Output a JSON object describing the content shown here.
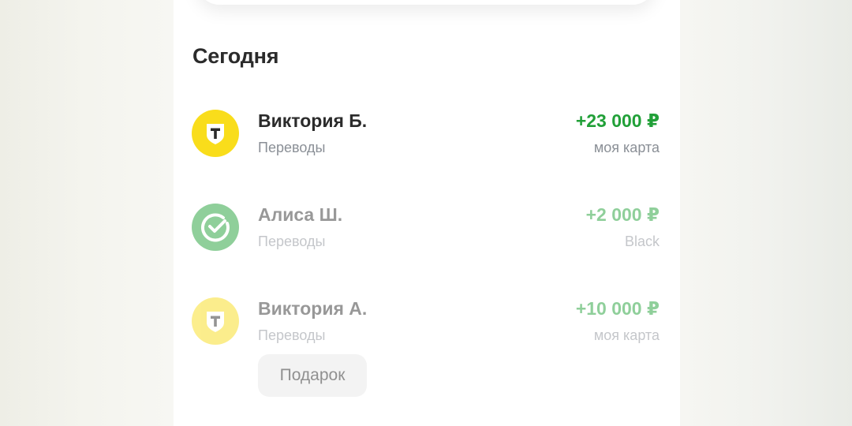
{
  "section": {
    "title": "Сегодня"
  },
  "transactions": [
    {
      "name": "Виктория Б.",
      "category": "Переводы",
      "amount": "+23 000 ₽",
      "account": "моя карта",
      "icon": "tbank-logo-icon"
    },
    {
      "name": "Алиса Ш.",
      "category": "Переводы",
      "amount": "+2 000 ₽",
      "account": "Black",
      "icon": "sber-logo-icon"
    },
    {
      "name": "Виктория А.",
      "category": "Переводы",
      "amount": "+10 000 ₽",
      "account": "моя карта",
      "icon": "tbank-logo-icon",
      "tag": "Подарок"
    }
  ],
  "colors": {
    "income_green": "#21a038",
    "tbank_yellow": "#f9dd1b",
    "sber_green": "#21a038",
    "secondary_text": "#8a8f96"
  }
}
